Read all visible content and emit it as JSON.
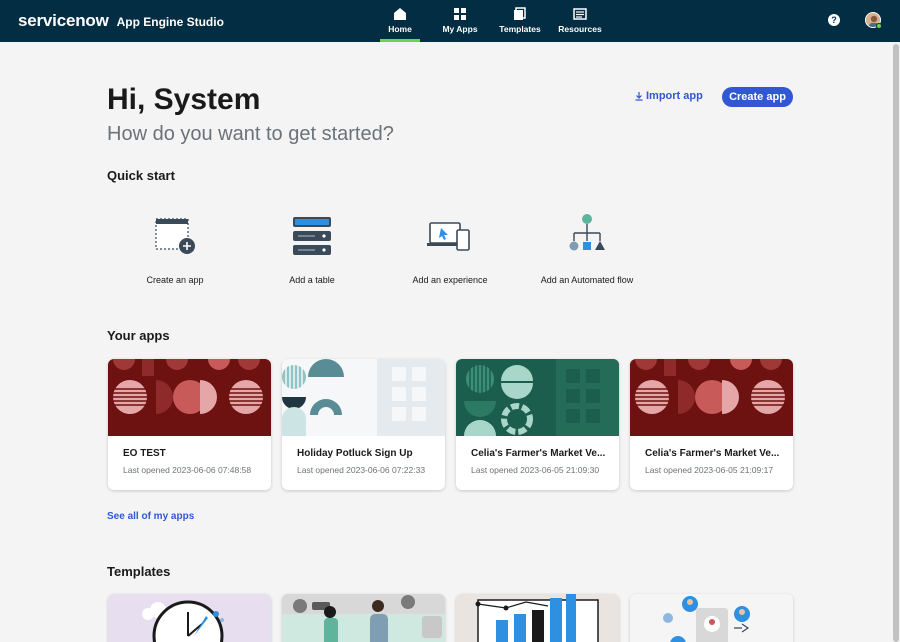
{
  "header": {
    "logo": "servicenow",
    "app_title": "App Engine Studio",
    "nav": [
      {
        "label": "Home",
        "icon": "home-icon",
        "active": true
      },
      {
        "label": "My Apps",
        "icon": "grid-icon",
        "active": false
      },
      {
        "label": "Templates",
        "icon": "templates-icon",
        "active": false
      },
      {
        "label": "Resources",
        "icon": "resources-icon",
        "active": false
      }
    ],
    "help": "?"
  },
  "hero": {
    "greeting": "Hi, System",
    "subtitle": "How do you want to get started?",
    "import_label": "Import app",
    "create_label": "Create app"
  },
  "quick_start": {
    "heading": "Quick start",
    "items": [
      {
        "label": "Create an app",
        "icon": "create-app-icon"
      },
      {
        "label": "Add a table",
        "icon": "table-icon"
      },
      {
        "label": "Add an experience",
        "icon": "experience-icon"
      },
      {
        "label": "Add an Automated flow",
        "icon": "flow-icon"
      }
    ]
  },
  "your_apps": {
    "heading": "Your apps",
    "apps": [
      {
        "name": "EO TEST",
        "opened": "Last opened 2023-06-06 07:48:58",
        "theme": "maroon"
      },
      {
        "name": "Holiday Potluck Sign Up",
        "opened": "Last opened 2023-06-06 07:22:33",
        "theme": "teal-light"
      },
      {
        "name": "Celia's Farmer's Market Ve...",
        "opened": "Last opened 2023-06-05 21:09:30",
        "theme": "green"
      },
      {
        "name": "Celia's Farmer's Market Ve...",
        "opened": "Last opened 2023-06-05 21:09:17",
        "theme": "maroon"
      }
    ],
    "see_all": "See all of my apps"
  },
  "templates": {
    "heading": "Templates"
  },
  "colors": {
    "header_bg": "#032d42",
    "accent": "#3157d4",
    "active_tab": "#62d84e",
    "maroon": "#7a1616",
    "green": "#1f6b58"
  }
}
